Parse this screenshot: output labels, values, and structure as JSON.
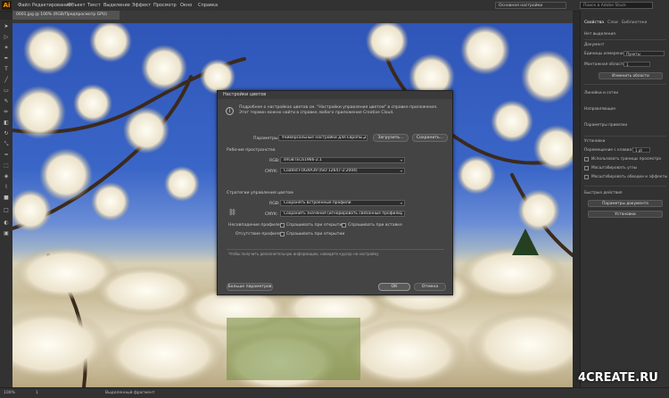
{
  "app": {
    "logo": "Ai"
  },
  "menubar": {
    "items": [
      "Файл",
      "Редактирование",
      "Объект",
      "Текст",
      "Выделение",
      "Эффект",
      "Просмотр",
      "Окно",
      "Справка"
    ],
    "workspace": "Основная настройки",
    "search_placeholder": "Поиск в Adobe Stock"
  },
  "document_tab": {
    "title": "0001.jpg @ 100% (RGB/Предпросмотр GPU)"
  },
  "status_bar": {
    "zoom": "100%",
    "page": "1",
    "mode": "Выделенный фрагмент"
  },
  "right_panel": {
    "tabs": [
      "Свойства",
      "Слои",
      "Библиотеки"
    ],
    "no_selection": "Нет выделения",
    "document_label": "Документ",
    "units_label": "Единицы измерения:",
    "units_value": "Пункты",
    "artboard_label": "Монтажная область:",
    "artboard_value": "1",
    "edit_artboards_button": "Изменить области",
    "rulers_label": "Линейки и сетки",
    "guides_label": "Направляющие",
    "snap_label": "Параметры привязки",
    "preferences_label": "Установки",
    "keyboard_increment_label": "Перемещение с клавиатуры:",
    "keyboard_increment_value": "1 pt",
    "scale_corners_label": "Использовать границы просмотра",
    "scale_corners_checkbox": "Масштабировать углы",
    "scale_strokes_checkbox": "Масштабировать обводки и эффекты",
    "quick_actions_label": "Быстрые действия",
    "document_setup_button": "Параметры документа",
    "preferences_button": "Установки"
  },
  "dialog": {
    "title": "Настройки цветов",
    "info_text": "Подробнее о настройках цветов см. \"Настройки управления цветом\" в справке приложения. Этот термин можно найти в справке любого приложения Creative Cloud.",
    "preset_label": "Параметры:",
    "preset_value": "Универсальные настройки для Европы 3",
    "load_button": "Загрузить...",
    "save_button": "Сохранить...",
    "working_spaces_heading": "Рабочие пространства",
    "rgb_label": "RGB:",
    "rgb_value": "sRGB IEC61966-2.1",
    "cmyk_label": "CMYK:",
    "cmyk_value": "Coated FOGRA39 (ISO 12647-2:2004)",
    "policies_heading": "Стратегии управления цветом",
    "policy_rgb_label": "RGB:",
    "policy_rgb_value": "Сохранять встроенные профили",
    "policy_cmyk_label": "CMYK:",
    "policy_cmyk_value": "Сохранить значения (игнорировать связанные профили)",
    "mismatch_label": "Несовпадение профилей:",
    "ask_open": "Спрашивать при открытии",
    "ask_paste": "Спрашивать при вставке",
    "missing_label": "Отсутствие профилей:",
    "ask_open2": "Спрашивать при открытии",
    "hint_text": "Чтобы получить дополнительную информацию, наведите курсор на настройку.",
    "more_options_button": "Больше параметров",
    "ok_button": "ОК",
    "cancel_button": "Отмена"
  },
  "watermark": {
    "text": "4CREATE.RU"
  },
  "colors": {
    "accent": "#ff9a00",
    "panel": "#323232",
    "dialog": "#444444",
    "sky": "#3a66c8"
  }
}
